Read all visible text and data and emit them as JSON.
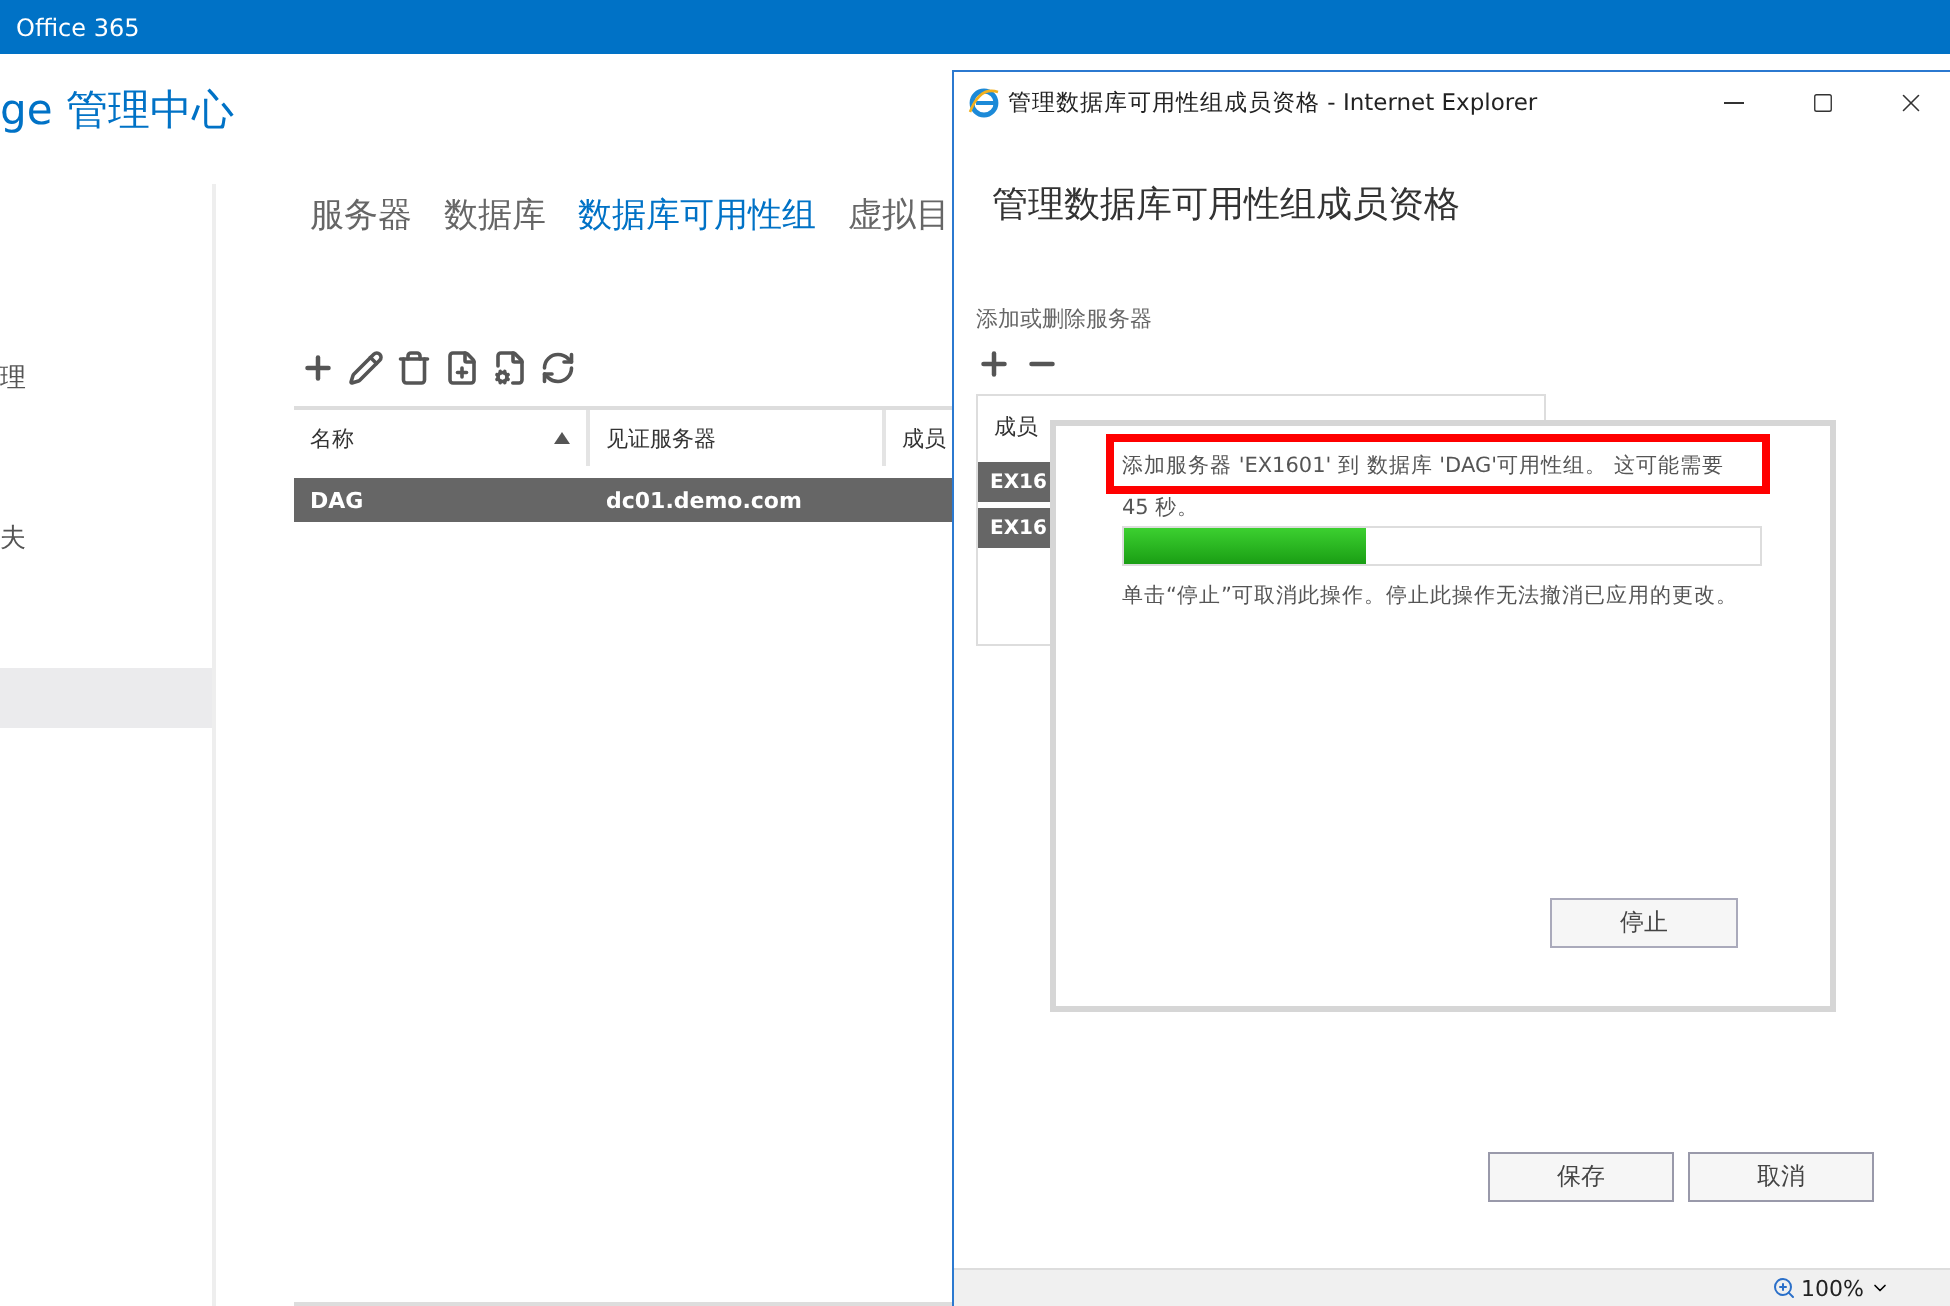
{
  "top_bar": {
    "title": "Office 365"
  },
  "app_title": "ge 管理中心",
  "nav": {
    "items": [
      {
        "label": "理",
        "selected": false
      },
      {
        "label": "夫",
        "selected": false
      },
      {
        "selected": true
      }
    ]
  },
  "tabs": [
    {
      "label": "服务器",
      "selected": false
    },
    {
      "label": "数据库",
      "selected": false
    },
    {
      "label": "数据库可用性组",
      "selected": true
    },
    {
      "label": "虚拟目",
      "selected": false
    }
  ],
  "table": {
    "columns": [
      {
        "label": "名称",
        "sorted": true
      },
      {
        "label": "见证服务器",
        "sorted": false
      },
      {
        "label": "成员",
        "sorted": false
      }
    ],
    "rows": [
      {
        "cells": [
          "DAG",
          "dc01.demo.com"
        ],
        "selected": true
      }
    ]
  },
  "popup": {
    "title": "管理数据库可用性组成员资格 - Internet Explorer",
    "heading": "管理数据库可用性组成员资格",
    "servers_label": "添加或删除服务器",
    "members": {
      "column": "成员",
      "rows": [
        {
          "name": "EX16",
          "selected": true
        },
        {
          "name": "EX16",
          "selected": true
        }
      ]
    },
    "progress_dialog": {
      "message": "添加服务器 'EX1601' 到 数据库 'DAG'可用性组。 这可能需要",
      "highlighted": true,
      "message_cont": "45 秒。",
      "level": 0.38,
      "note": "单击“停止”可取消此操作。停止此操作无法撤消已应用的更改。",
      "stop_button": "停止"
    },
    "buttons": [
      "保存",
      "取消"
    ],
    "status_bar": {
      "zoom": "100%"
    }
  }
}
